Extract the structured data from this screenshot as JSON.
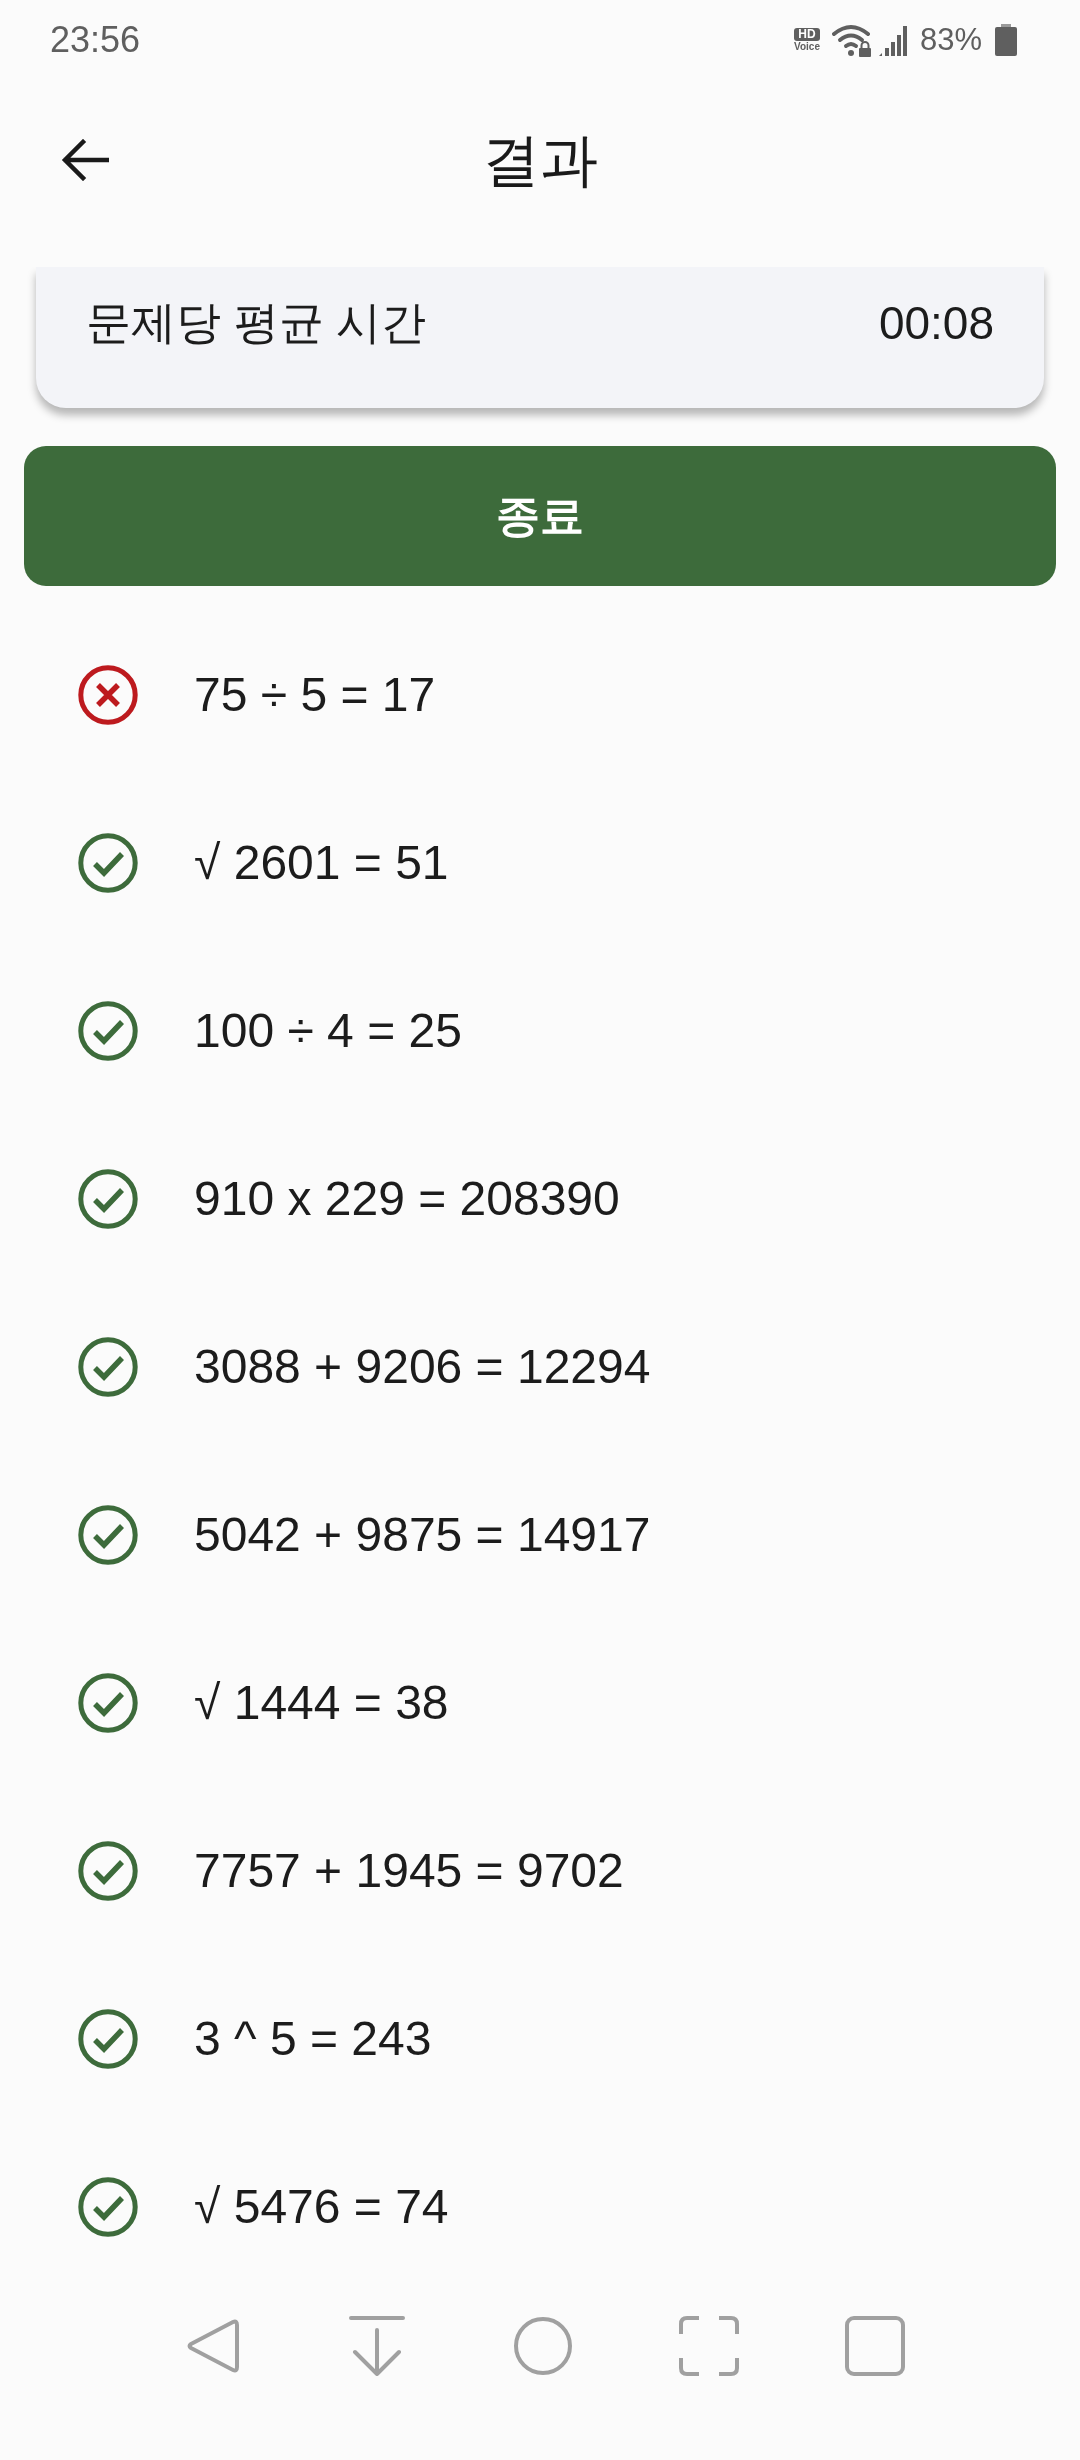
{
  "status_bar": {
    "time": "23:56",
    "hd_voice": {
      "top": "HD",
      "bottom": "Voice"
    },
    "battery_percent": "83%"
  },
  "header": {
    "title": "결과"
  },
  "summary_card": {
    "label": "문제당 평균 시간",
    "value": "00:08"
  },
  "finish_button": {
    "label": "종료"
  },
  "results": [
    {
      "expression": "75 ÷ 5 = 17",
      "correct": false
    },
    {
      "expression": "√ 2601 = 51",
      "correct": true
    },
    {
      "expression": "100 ÷ 4 = 25",
      "correct": true
    },
    {
      "expression": "910 x 229 = 208390",
      "correct": true
    },
    {
      "expression": "3088 + 9206 = 12294",
      "correct": true
    },
    {
      "expression": "5042 + 9875 = 14917",
      "correct": true
    },
    {
      "expression": "√ 1444 = 38",
      "correct": true
    },
    {
      "expression": "7757 + 1945 = 9702",
      "correct": true
    },
    {
      "expression": "3 ^ 5 = 243",
      "correct": true
    },
    {
      "expression": "√ 5476 = 74",
      "correct": true
    }
  ]
}
